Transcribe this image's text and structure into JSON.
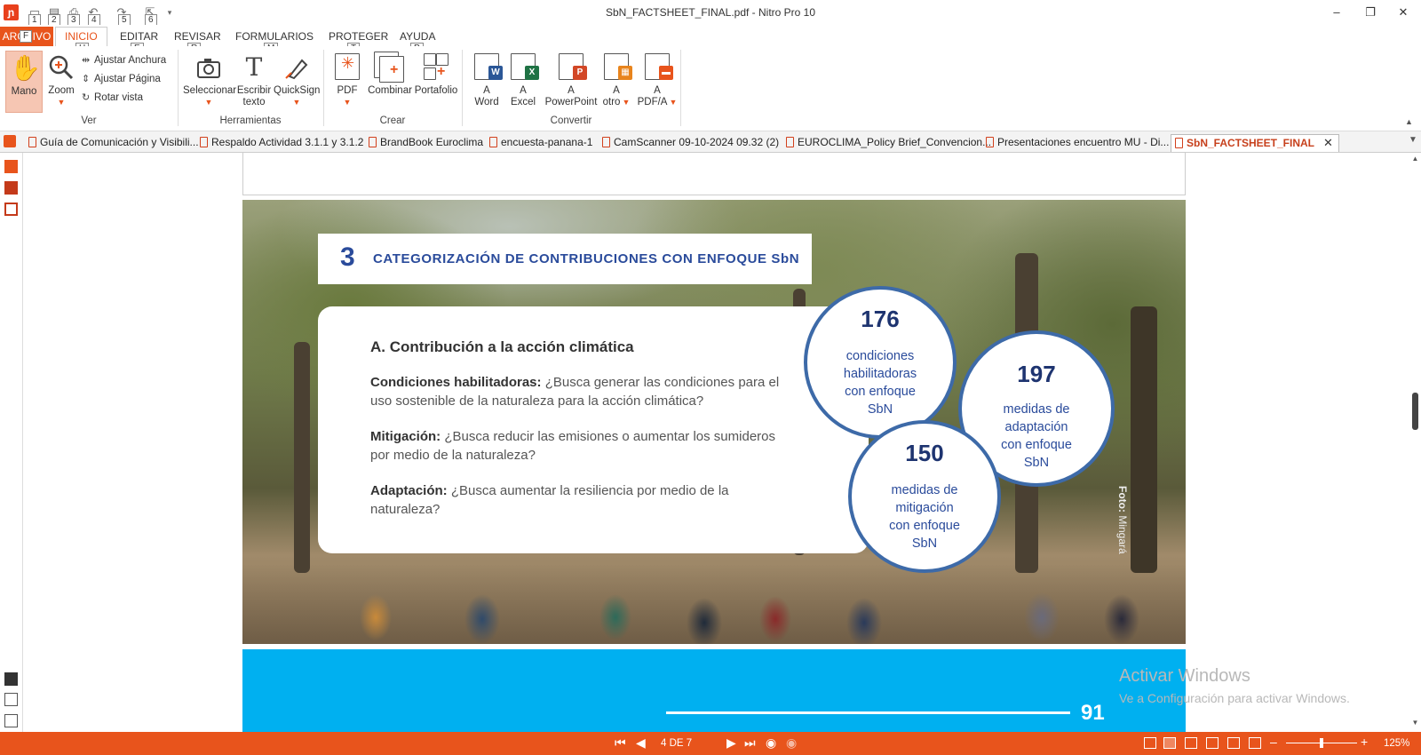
{
  "window": {
    "title": "SbN_FACTSHEET_FINAL.pdf - Nitro Pro 10",
    "minimize": "–",
    "restore": "❐",
    "close": "✕"
  },
  "quick_access": {
    "keytips": [
      "1",
      "2",
      "3",
      "4",
      "5",
      "6"
    ]
  },
  "ribbon_tabs": [
    {
      "label": "ARCHIVO",
      "keytip": "F"
    },
    {
      "label": "INICIO",
      "keytip": "H"
    },
    {
      "label": "EDITAR",
      "keytip": "E"
    },
    {
      "label": "REVISAR",
      "keytip": "R"
    },
    {
      "label": "FORMULARIOS",
      "keytip": "M"
    },
    {
      "label": "PROTEGER",
      "keytip": "T"
    },
    {
      "label": "AYUDA",
      "keytip": "P"
    }
  ],
  "ribbon": {
    "ver": {
      "label": "Ver",
      "mano": "Mano",
      "zoom": "Zoom",
      "ajustar_anchura": "Ajustar Anchura",
      "ajustar_pagina": "Ajustar Página",
      "rotar_vista": "Rotar vista"
    },
    "herramientas": {
      "label": "Herramientas",
      "seleccionar": "Seleccionar",
      "escribir_1": "Escribir",
      "escribir_2": "texto",
      "quicksign": "QuickSign"
    },
    "crear": {
      "label": "Crear",
      "pdf": "PDF",
      "combinar": "Combinar",
      "portafolio": "Portafolio"
    },
    "convertir": {
      "label": "Convertir",
      "word_1": "A",
      "word_2": "Word",
      "excel_1": "A",
      "excel_2": "Excel",
      "ppt_1": "A",
      "ppt_2": "PowerPoint",
      "otro_1": "A",
      "otro_2": "otro",
      "pdfa_1": "A",
      "pdfa_2": "PDF/A"
    }
  },
  "document_tabs": [
    "Guía de Comunicación y Visibili...",
    "Respaldo Actividad 3.1.1 y 3.1.2",
    "BrandBook Euroclima",
    "encuesta-panana-1",
    "CamScanner 09-10-2024 09.32 (2)",
    "EUROCLIMA_Policy Brief_Convencion...",
    "Presentaciones encuentro MU - Di...",
    "SbN_FACTSHEET_FINAL"
  ],
  "page": {
    "section_number": "3",
    "section_title": "CATEGORIZACIÓN DE CONTRIBUCIONES CON ENFOQUE SbN",
    "box_title": "A. Contribución a la acción climática",
    "items": [
      {
        "label": "Condiciones habilitadoras:",
        "text": " ¿Busca generar las condiciones para el uso sostenible de la naturaleza para la acción climática?"
      },
      {
        "label": "Mitigación:",
        "text": " ¿Busca reducir las emisiones o aumentar los sumideros por medio de la naturaleza?"
      },
      {
        "label": "Adaptación:",
        "text": " ¿Busca aumentar la resiliencia por medio de la naturaleza?"
      }
    ],
    "circles": [
      {
        "number": "176",
        "l1": "condiciones",
        "l2": "habilitadoras",
        "l3": "con enfoque",
        "l4": "SbN"
      },
      {
        "number": "197",
        "l1": "medidas de",
        "l2": "adaptación",
        "l3": "con enfoque",
        "l4": "SbN"
      },
      {
        "number": "150",
        "l1": "medidas de",
        "l2": "mitigación",
        "l3": "con enfoque",
        "l4": "SbN"
      }
    ],
    "photo_credit_bold": "Foto:",
    "photo_credit": " Mingará",
    "page_number": "91"
  },
  "watermark": {
    "line1": "Activar Windows",
    "line2": "Ve a Configuración para activar Windows."
  },
  "statusbar": {
    "page_indicator": "4 DE 7",
    "zoom": "125%",
    "zoom_minus": "–",
    "zoom_plus": "+"
  },
  "colors": {
    "accent": "#e8541c",
    "heading_blue": "#2a4b9b",
    "band_blue": "#00b0f0"
  }
}
